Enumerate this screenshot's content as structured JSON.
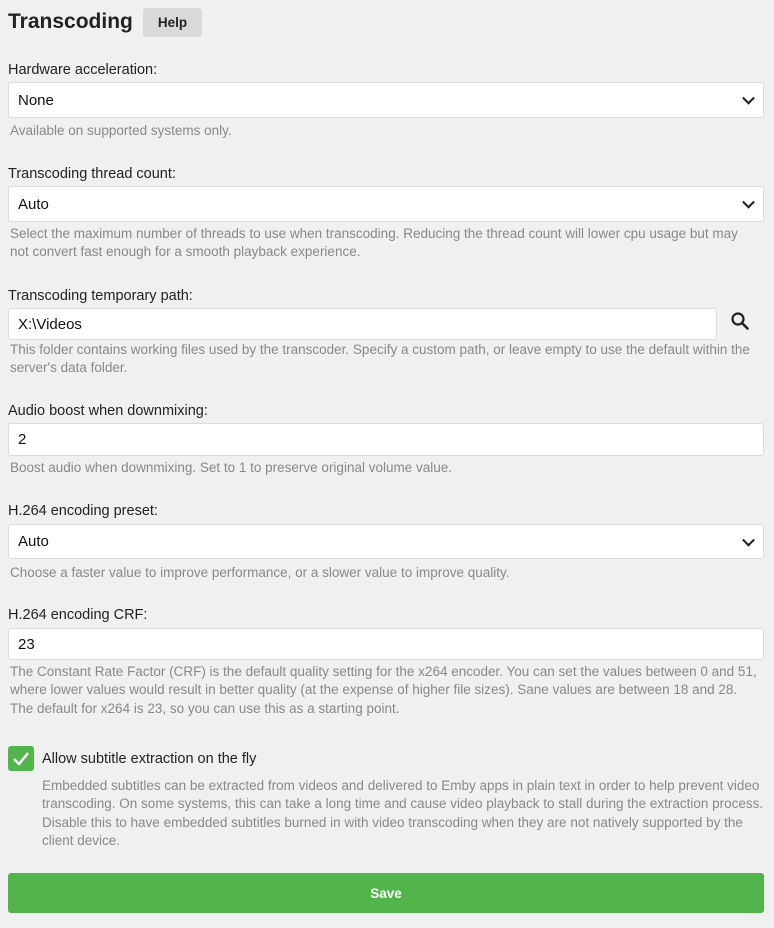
{
  "header": {
    "title": "Transcoding",
    "help_label": "Help"
  },
  "hardware_acceleration": {
    "label": "Hardware acceleration:",
    "value": "None",
    "hint": "Available on supported systems only."
  },
  "thread_count": {
    "label": "Transcoding thread count:",
    "value": "Auto",
    "hint": "Select the maximum number of threads to use when transcoding. Reducing the thread count will lower cpu usage but may not convert fast enough for a smooth playback experience."
  },
  "temp_path": {
    "label": "Transcoding temporary path:",
    "value": "X:\\Videos",
    "hint": "This folder contains working files used by the transcoder. Specify a custom path, or leave empty to use the default within the server's data folder."
  },
  "audio_boost": {
    "label": "Audio boost when downmixing:",
    "value": "2",
    "hint": "Boost audio when downmixing. Set to 1 to preserve original volume value."
  },
  "h264_preset": {
    "label": "H.264 encoding preset:",
    "value": "Auto",
    "hint": "Choose a faster value to improve performance, or a slower value to improve quality."
  },
  "h264_crf": {
    "label": "H.264 encoding CRF:",
    "value": "23",
    "hint": "The Constant Rate Factor (CRF) is the default quality setting for the x264 encoder. You can set the values between 0 and 51, where lower values would result in better quality (at the expense of higher file sizes). Sane values are between 18 and 28. The default for x264 is 23, so you can use this as a starting point."
  },
  "subtitle_extraction": {
    "label": "Allow subtitle extraction on the fly",
    "checked": true,
    "hint": "Embedded subtitles can be extracted from videos and delivered to Emby apps in plain text in order to help prevent video transcoding. On some systems, this can take a long time and cause video playback to stall during the extraction process. Disable this to have embedded subtitles burned in with video transcoding when they are not natively supported by the client device."
  },
  "save_label": "Save",
  "colors": {
    "accent": "#52b54b",
    "background": "#f0f0f0"
  }
}
